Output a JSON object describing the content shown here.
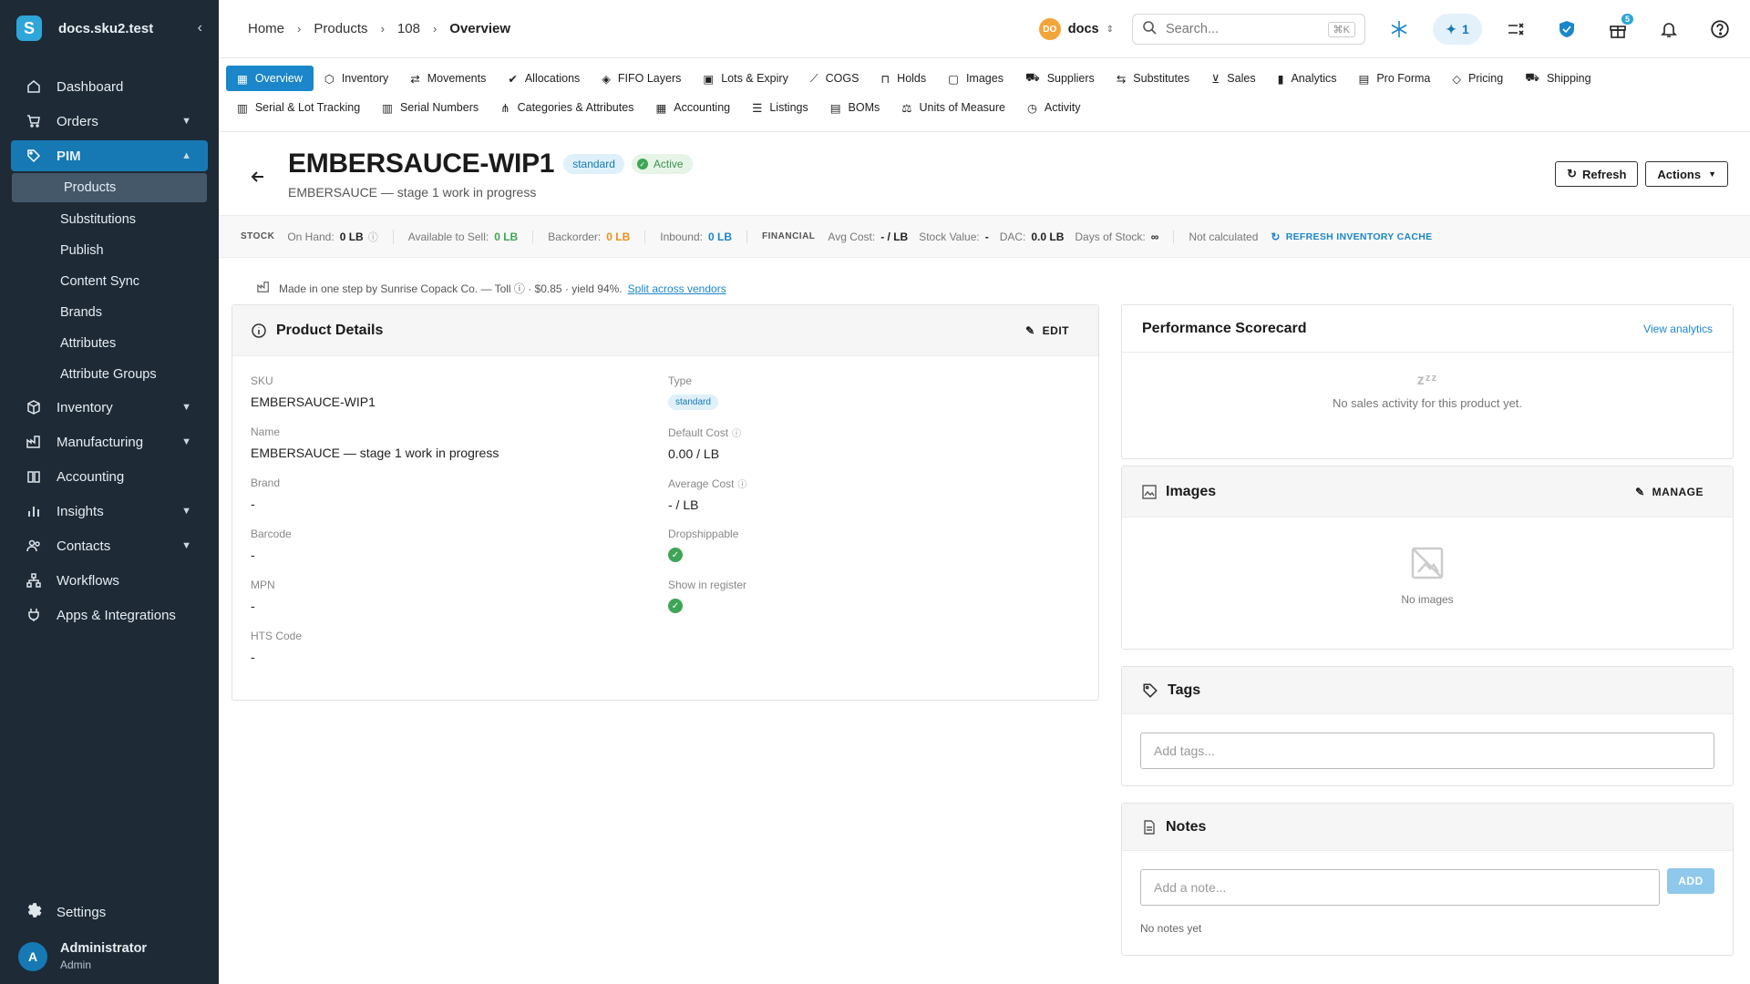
{
  "sidebar": {
    "site": "docs.sku2.test",
    "logo_letter": "S",
    "items": [
      {
        "label": "Dashboard",
        "icon": "home-icon"
      },
      {
        "label": "Orders",
        "icon": "cart-icon"
      },
      {
        "label": "PIM",
        "icon": "tag-icon"
      },
      {
        "label": "Inventory",
        "icon": "cube-icon"
      },
      {
        "label": "Manufacturing",
        "icon": "factory-icon"
      },
      {
        "label": "Accounting",
        "icon": "book-icon"
      },
      {
        "label": "Insights",
        "icon": "bar-chart-icon"
      },
      {
        "label": "Contacts",
        "icon": "contacts-icon"
      },
      {
        "label": "Workflows",
        "icon": "workflow-icon"
      },
      {
        "label": "Apps & Integrations",
        "icon": "plug-icon"
      }
    ],
    "pim_sub": [
      "Products",
      "Substitutions",
      "Publish",
      "Content Sync",
      "Brands",
      "Attributes",
      "Attribute Groups"
    ],
    "settings": "Settings",
    "user": {
      "initial": "A",
      "name": "Administrator",
      "role": "Admin"
    }
  },
  "topbar": {
    "breadcrumb": [
      "Home",
      "Products",
      "108",
      "Overview"
    ],
    "org_initials": "DO",
    "org_name": "docs",
    "search_placeholder": "Search...",
    "search_shortcut": "⌘K",
    "ai_count": "1",
    "gift_badge": "5"
  },
  "tabs": {
    "row1": [
      "Overview",
      "Inventory",
      "Movements",
      "Allocations",
      "FIFO Layers",
      "Lots & Expiry",
      "COGS",
      "Holds",
      "Images",
      "Suppliers",
      "Substitutes",
      "Sales",
      "Analytics",
      "Pro Forma",
      "Pricing",
      "Shipping"
    ],
    "row2": [
      "Serial & Lot Tracking",
      "Serial Numbers",
      "Categories & Attributes",
      "Accounting",
      "Listings",
      "BOMs",
      "Units of Measure",
      "Activity"
    ]
  },
  "product": {
    "sku": "EMBERSAUCE-WIP1",
    "type_chip": "standard",
    "status_chip": "Active",
    "subtitle": "EMBERSAUCE — stage 1 work in progress",
    "refresh_btn": "Refresh",
    "actions_btn": "Actions"
  },
  "stats": {
    "stock_label": "STOCK",
    "on_hand_label": "On Hand:",
    "on_hand": "0 LB",
    "avail_label": "Available to Sell:",
    "avail": "0 LB",
    "backorder_label": "Backorder:",
    "backorder": "0 LB",
    "inbound_label": "Inbound:",
    "inbound": "0 LB",
    "financial_label": "FINANCIAL",
    "avg_cost_label": "Avg Cost:",
    "avg_cost": "- / LB",
    "stock_value_label": "Stock Value:",
    "stock_value": "-",
    "dac_label": "DAC:",
    "dac": "0.0 LB",
    "days_label": "Days of Stock:",
    "days": "∞",
    "not_calc": "Not calculated",
    "refresh_cache": "REFRESH INVENTORY CACHE"
  },
  "manufacture_note": {
    "text": "Made in one step by Sunrise Copack Co. — Toll ⓘ · $0.85 · yield 94%.",
    "link": "Split across vendors"
  },
  "details": {
    "title": "Product Details",
    "edit": "EDIT",
    "left": [
      {
        "label": "SKU",
        "value": "EMBERSAUCE-WIP1"
      },
      {
        "label": "Name",
        "value": "EMBERSAUCE — stage 1 work in progress"
      },
      {
        "label": "Brand",
        "value": "-"
      },
      {
        "label": "Barcode",
        "value": "-"
      },
      {
        "label": "MPN",
        "value": "-"
      },
      {
        "label": "HTS Code",
        "value": "-"
      }
    ],
    "right": [
      {
        "label": "Type",
        "value": "standard"
      },
      {
        "label": "Default Cost",
        "value": "0.00 / LB"
      },
      {
        "label": "Average Cost",
        "value": "- / LB"
      },
      {
        "label": "Dropshippable",
        "value": ""
      },
      {
        "label": "Show in register",
        "value": ""
      }
    ]
  },
  "scorecard": {
    "title": "Performance Scorecard",
    "link": "View analytics",
    "empty": "No sales activity for this product yet."
  },
  "images": {
    "title": "Images",
    "manage": "MANAGE",
    "empty": "No images"
  },
  "tags": {
    "title": "Tags",
    "placeholder": "Add tags..."
  },
  "notes": {
    "title": "Notes",
    "placeholder": "Add a note...",
    "add": "ADD",
    "empty": "No notes yet"
  },
  "colors": {
    "sidebar_bg": "#1e2a36",
    "accent": "#1b86c9",
    "success": "#3fa556",
    "warning": "#e8901a"
  }
}
